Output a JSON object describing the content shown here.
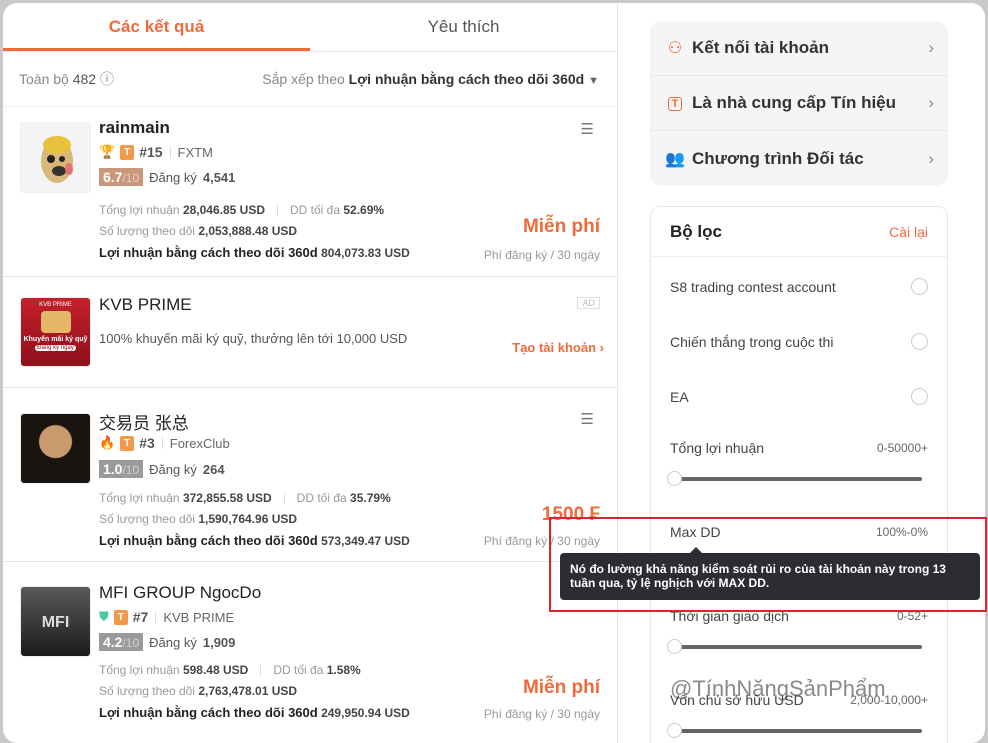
{
  "tabs": [
    {
      "label": "Các kết quả",
      "active": true
    },
    {
      "label": "Yêu thích",
      "active": false
    }
  ],
  "summary": {
    "total_label": "Toàn bộ",
    "total": "482",
    "sort_label": "Sắp xếp theo",
    "sort_value": "Lợi nhuận bằng cách theo dõi 360d"
  },
  "labels": {
    "total_profit": "Tổng lợi nhuận",
    "max_dd": "DD tối đa",
    "follow_amount": "Số lượng theo dõi",
    "profit_360": "Lợi nhuận bằng cách theo dõi 360d",
    "subscribe": "Đăng ký",
    "fee": "Phí đăng ký / 30 ngày",
    "score_max": "/10"
  },
  "traders": [
    {
      "name": "rainmain",
      "rank": "#15",
      "broker": "FXTM",
      "score": "6.7",
      "score_color": "#c9977a",
      "subs": "4,541",
      "total_profit": "28,046.85 USD",
      "max_dd": "52.69%",
      "follow": "2,053,888.48 USD",
      "profit360": "804,073.83 USD",
      "price": "Miễn phí",
      "badge": "trophy"
    },
    {
      "name": "交易员 张总",
      "rank": "#3",
      "broker": "ForexClub",
      "score": "1.0",
      "score_color": "#9a9a9a",
      "subs": "264",
      "total_profit": "372,855.58 USD",
      "max_dd": "35.79%",
      "follow": "1,590,764.96 USD",
      "profit360": "573,349.47 USD",
      "price": "1500 ₣",
      "badge": "fire"
    },
    {
      "name": "MFI GROUP NgocDo",
      "rank": "#7",
      "broker": "KVB PRIME",
      "score": "4.2",
      "score_color": "#9a9a9a",
      "subs": "1,909",
      "total_profit": "598.48 USD",
      "max_dd": "1.58%",
      "follow": "2,763,478.01 USD",
      "profit360": "249,950.94 USD",
      "price": "Miễn phí",
      "badge": "shield"
    }
  ],
  "ad": {
    "title": "KVB PRIME",
    "text": "100% khuyến mãi ký quỹ, thưởng lên tới 10,000 USD",
    "tag": "AD",
    "cta": "Tạo tài khoản",
    "image_brand": "KVB PRIME",
    "image_text": "Khuyến mãi ký quỹ",
    "image_button": "Đăng ký ngay"
  },
  "menu": [
    {
      "label": "Kết nối tài khoản",
      "icon": "user-plus"
    },
    {
      "label": "Là nhà cung cấp Tín hiệu",
      "icon": "t-badge"
    },
    {
      "label": "Chương trình Đối tác",
      "icon": "partners"
    }
  ],
  "filter": {
    "title": "Bộ lọc",
    "reset": "Cài lại",
    "toggles": [
      "S8 trading contest account",
      "Chiến thắng trong cuộc thi",
      "EA"
    ],
    "ranges": [
      {
        "label": "Tổng lợi nhuận",
        "value": "0-50000+"
      },
      {
        "label": "Max DD",
        "value": "100%-0%"
      },
      {
        "label": "Thời gian giao dịch",
        "value": "0-52+"
      },
      {
        "label": "Vốn chủ sở hữu USD",
        "value": "2,000-10,000+"
      }
    ]
  },
  "tooltip": "Nó đo lường khả năng kiểm soát rủi ro của tài khoản này trong 13 tuần qua, tỷ lệ nghịch với MAX DD.",
  "watermark": "@TínhNăngSảnPhẩm",
  "colors": {
    "accent": "#f06a3c",
    "tooltip_bg": "#2b2d31",
    "highlight": "#d9252b"
  }
}
